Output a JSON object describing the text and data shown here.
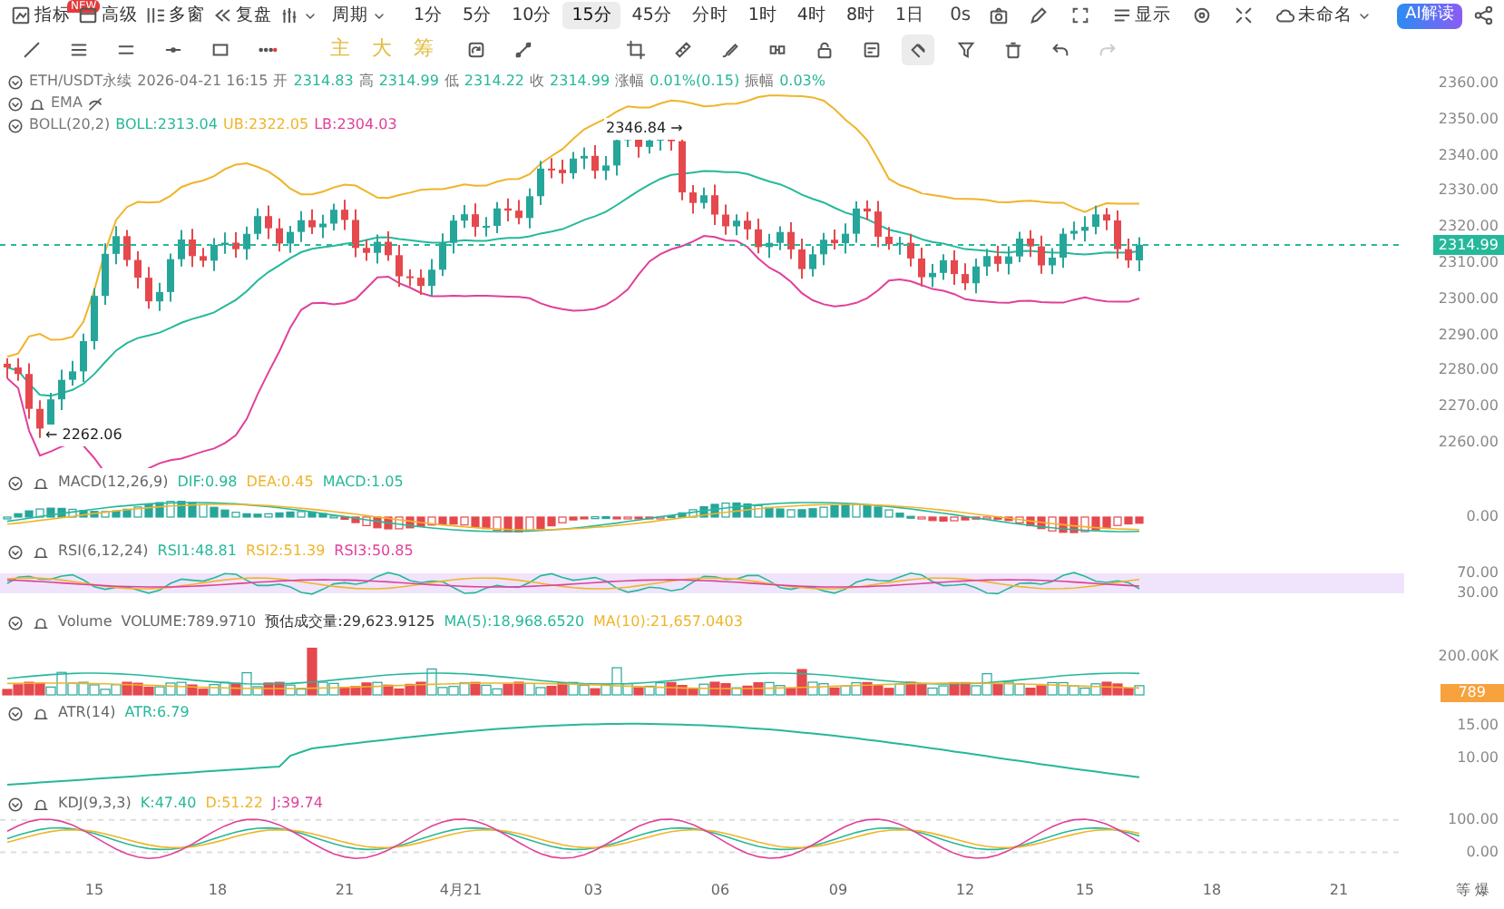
{
  "toolbar": {
    "buttons": [
      {
        "label": "指标",
        "badge": "NEW"
      },
      {
        "label": "高级"
      },
      {
        "label": "多窗"
      },
      {
        "label": "复盘"
      }
    ],
    "period_label": "周期",
    "intervals": [
      {
        "label": "1分",
        "selected": false
      },
      {
        "label": "5分",
        "selected": false
      },
      {
        "label": "10分",
        "selected": false
      },
      {
        "label": "15分",
        "selected": true
      },
      {
        "label": "45分",
        "selected": false
      },
      {
        "label": "分时",
        "selected": false
      },
      {
        "label": "1时",
        "selected": false
      },
      {
        "label": "4时",
        "selected": false
      },
      {
        "label": "8时",
        "selected": false
      },
      {
        "label": "1日",
        "selected": false
      }
    ],
    "countdown": "0s",
    "display_label": "显示",
    "layout_name": "未命名",
    "ai_button": "AI解读"
  },
  "drawing_toolbar": {
    "letters": [
      "主",
      "大",
      "筹"
    ]
  },
  "main_chart": {
    "symbol": "ETH/USDT永续",
    "time": "2026-04-21 16:15",
    "fields": [
      {
        "label": "开",
        "value": "2314.83"
      },
      {
        "label": "高",
        "value": "2314.99"
      },
      {
        "label": "低",
        "value": "2314.22"
      },
      {
        "label": "收",
        "value": "2314.99"
      },
      {
        "label": "涨幅",
        "value": "0.01%(0.15)"
      },
      {
        "label": "振幅",
        "value": "0.03%"
      }
    ],
    "ema_label": "EMA",
    "boll_name": "BOLL(20,2)",
    "boll_values": [
      {
        "text": "BOLL:2313.04",
        "color": "#26b89a"
      },
      {
        "text": "UB:2322.05",
        "color": "#f0b429"
      },
      {
        "text": "LB:2304.03",
        "color": "#e0409a"
      }
    ],
    "high_marker": "2346.84 →",
    "low_marker": "← 2262.06",
    "last_price": "2314.99",
    "yticks": [
      "2360.00",
      "2350.00",
      "2340.00",
      "2330.00",
      "2320.00",
      "2310.00",
      "2300.00",
      "2290.00",
      "2280.00",
      "2270.00",
      "2260.00"
    ]
  },
  "indicators": [
    {
      "kind": "macd",
      "name": "MACD(12,26,9)",
      "values": [
        {
          "text": "DIF:0.98",
          "color": "#26b89a"
        },
        {
          "text": "DEA:0.45",
          "color": "#f0b429"
        },
        {
          "text": "MACD:1.05",
          "color": "#26b89a"
        }
      ],
      "ticks": [
        "0.00"
      ]
    },
    {
      "kind": "rsi",
      "name": "RSI(6,12,24)",
      "values": [
        {
          "text": "RSI1:48.81",
          "color": "#26b89a"
        },
        {
          "text": "RSI2:51.39",
          "color": "#f0b429"
        },
        {
          "text": "RSI3:50.85",
          "color": "#e0409a"
        }
      ],
      "ticks": [
        "70.00",
        "30.00"
      ]
    },
    {
      "kind": "volume",
      "name": "Volume",
      "values": [
        {
          "text": "VOLUME:789.9710",
          "color": "#666666"
        },
        {
          "text": "预估成交量:29,623.9125",
          "color": "#333333"
        },
        {
          "text": "MA(5):18,968.6520",
          "color": "#26b89a"
        },
        {
          "text": "MA(10):21,657.0403",
          "color": "#f0b429"
        }
      ],
      "ticks": [
        "200.00K"
      ],
      "last": "789"
    },
    {
      "kind": "atr",
      "name": "ATR(14)",
      "values": [
        {
          "text": "ATR:6.79",
          "color": "#26b89a"
        }
      ],
      "ticks": [
        "15.00",
        "10.00"
      ]
    },
    {
      "kind": "kdj",
      "name": "KDJ(9,3,3)",
      "values": [
        {
          "text": "K:47.40",
          "color": "#26b89a"
        },
        {
          "text": "D:51.22",
          "color": "#f0b429"
        },
        {
          "text": "J:39.74",
          "color": "#e0409a"
        }
      ],
      "ticks": [
        "100.00",
        "0.00"
      ]
    }
  ],
  "x_axis": {
    "labels": [
      "15",
      "18",
      "21",
      "4月21",
      "03",
      "06",
      "09",
      "12",
      "15",
      "18",
      "21"
    ],
    "corner": "等 爆"
  }
}
